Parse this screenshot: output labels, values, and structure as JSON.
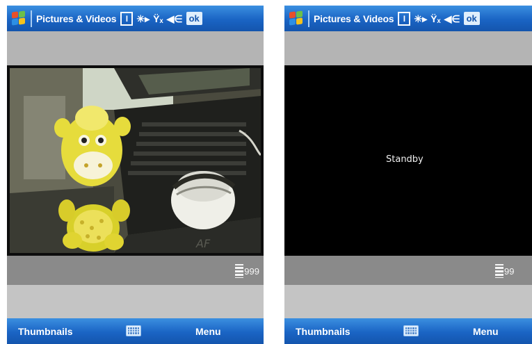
{
  "screens": [
    {
      "id": "left",
      "title_bar": {
        "app_title": "Pictures & Videos",
        "icons": [
          "start-menu-icon",
          "input-panel-icon",
          "connectivity-icon",
          "signal-icon",
          "volume-icon"
        ],
        "ok_label": "ok"
      },
      "viewer": {
        "mode": "photo-preview"
      },
      "counter": {
        "value": "999",
        "icon": "film-counter-icon"
      },
      "softkeys": {
        "left": "Thumbnails",
        "center_icon": "keyboard-icon",
        "right": "Menu"
      }
    },
    {
      "id": "right",
      "title_bar": {
        "app_title": "Pictures & Videos",
        "icons": [
          "start-menu-icon",
          "input-panel-icon",
          "connectivity-icon",
          "signal-icon",
          "volume-icon"
        ],
        "ok_label": "ok"
      },
      "viewer": {
        "mode": "standby",
        "status_text": "Standby"
      },
      "counter": {
        "value": "99",
        "icon": "film-counter-icon"
      },
      "softkeys": {
        "left": "Thumbnails",
        "center_icon": "keyboard-icon",
        "right": "Menu"
      }
    }
  ],
  "colors": {
    "title_bar_blue": "#1a64c4",
    "gray_band": "#b4b4b4",
    "counter_bar": "#8a8a8a",
    "viewer_background": "#000000"
  }
}
